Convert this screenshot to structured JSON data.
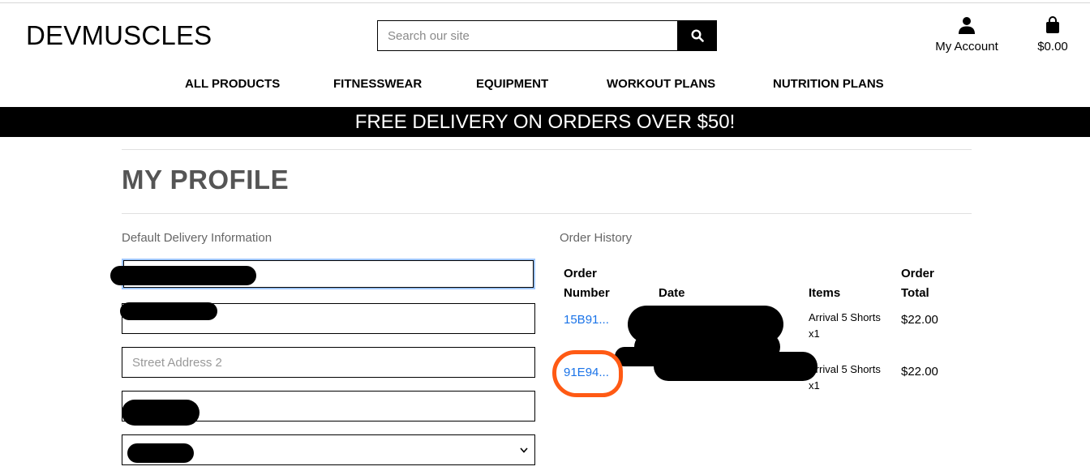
{
  "header": {
    "logo": "DEVMUSCLES",
    "search": {
      "placeholder": "Search our site"
    },
    "account_label": "My Account",
    "bag_total": "$0.00"
  },
  "nav": {
    "items": [
      "ALL PRODUCTS",
      "FITNESSWEAR",
      "EQUIPMENT",
      "WORKOUT PLANS",
      "NUTRITION PLANS"
    ]
  },
  "banner": {
    "text": "FREE DELIVERY ON ORDERS OVER $50!"
  },
  "page": {
    "title": "MY PROFILE"
  },
  "delivery": {
    "heading": "Default Delivery Information",
    "street_address_2_placeholder": "Street Address 2"
  },
  "orders": {
    "heading": "Order History",
    "columns": [
      "Order Number",
      "Date",
      "Items",
      "Order Total"
    ],
    "rows": [
      {
        "number": "15B91...",
        "items": "Arrival 5 Shorts x1",
        "total": "$22.00"
      },
      {
        "number": "91E94...",
        "items": "Arrival 5 Shorts x1",
        "total": "$22.00"
      }
    ]
  },
  "colors": {
    "accent_link": "#1a73e8",
    "annotation": "#ff5a14",
    "banner_bg": "#000000"
  }
}
